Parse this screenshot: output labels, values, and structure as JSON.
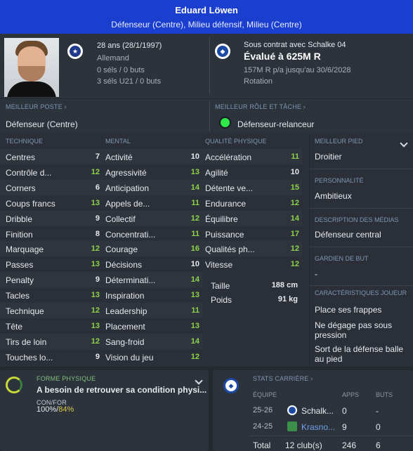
{
  "header": {
    "player_name": "Eduard Löwen",
    "positions": "Défenseur (Centre), Milieu défensif, Milieu (Centre)"
  },
  "profile": {
    "age": "28 ans (28/1/1997)",
    "nationality": "Allemand",
    "caps": "0 séls / 0 buts",
    "u21_caps": "3 séls U21 / 0 buts",
    "contract": "Sous contrat avec Schalke 04",
    "value": "Évalué à 625M R",
    "wage": "157M R p/a jusqu'au 30/6/2028",
    "squad_status": "Rotation"
  },
  "best_position": {
    "label": "MEILLEUR POSTE",
    "value": "Défenseur (Centre)"
  },
  "best_role": {
    "label": "MEILLEUR RÔLE ET TÂCHE",
    "value": "Défenseur-relanceur"
  },
  "technique": {
    "label": "TECHNIQUE",
    "items": [
      {
        "name": "Centres",
        "value": "7",
        "color": "white"
      },
      {
        "name": "Contrôle d...",
        "value": "12",
        "color": "green"
      },
      {
        "name": "Corners",
        "value": "6",
        "color": "white"
      },
      {
        "name": "Coups francs",
        "value": "13",
        "color": "green"
      },
      {
        "name": "Dribble",
        "value": "9",
        "color": "white"
      },
      {
        "name": "Finition",
        "value": "8",
        "color": "white"
      },
      {
        "name": "Marquage",
        "value": "12",
        "color": "green"
      },
      {
        "name": "Passes",
        "value": "13",
        "color": "green"
      },
      {
        "name": "Penalty",
        "value": "9",
        "color": "white"
      },
      {
        "name": "Tacles",
        "value": "13",
        "color": "green"
      },
      {
        "name": "Technique",
        "value": "12",
        "color": "green"
      },
      {
        "name": "Tête",
        "value": "13",
        "color": "green"
      },
      {
        "name": "Tirs de loin",
        "value": "12",
        "color": "green"
      },
      {
        "name": "Touches lo...",
        "value": "9",
        "color": "white"
      }
    ]
  },
  "mental": {
    "label": "MENTAL",
    "items": [
      {
        "name": "Activité",
        "value": "10",
        "color": "white"
      },
      {
        "name": "Agressivité",
        "value": "13",
        "color": "green"
      },
      {
        "name": "Anticipation",
        "value": "14",
        "color": "green"
      },
      {
        "name": "Appels de...",
        "value": "11",
        "color": "green"
      },
      {
        "name": "Collectif",
        "value": "12",
        "color": "green"
      },
      {
        "name": "Concentrati...",
        "value": "11",
        "color": "green"
      },
      {
        "name": "Courage",
        "value": "16",
        "color": "green"
      },
      {
        "name": "Décisions",
        "value": "10",
        "color": "white"
      },
      {
        "name": "Déterminati...",
        "value": "14",
        "color": "green"
      },
      {
        "name": "Inspiration",
        "value": "13",
        "color": "green"
      },
      {
        "name": "Leadership",
        "value": "11",
        "color": "green"
      },
      {
        "name": "Placement",
        "value": "13",
        "color": "green"
      },
      {
        "name": "Sang-froid",
        "value": "14",
        "color": "green"
      },
      {
        "name": "Vision du jeu",
        "value": "12",
        "color": "green"
      }
    ]
  },
  "physical": {
    "label": "QUALITÉ PHYSIQUE",
    "items": [
      {
        "name": "Accélération",
        "value": "11",
        "color": "green"
      },
      {
        "name": "Agilité",
        "value": "10",
        "color": "white"
      },
      {
        "name": "Détente ve...",
        "value": "15",
        "color": "green"
      },
      {
        "name": "Endurance",
        "value": "12",
        "color": "green"
      },
      {
        "name": "Équilibre",
        "value": "14",
        "color": "green"
      },
      {
        "name": "Puissance",
        "value": "17",
        "color": "green"
      },
      {
        "name": "Qualités ph...",
        "value": "12",
        "color": "green"
      },
      {
        "name": "Vitesse",
        "value": "12",
        "color": "green"
      }
    ],
    "height_label": "Taille",
    "height_value": "188 cm",
    "weight_label": "Poids",
    "weight_value": "91 kg"
  },
  "right_panel": {
    "best_foot_label": "MEILLEUR PIED",
    "best_foot": "Droitier",
    "personality_label": "PERSONNALITÉ",
    "personality": "Ambitieux",
    "media_label": "DESCRIPTION DES MÉDIAS",
    "media": "Défenseur central",
    "gk_label": "GARDIEN DE BUT",
    "gk": "-",
    "traits_label": "CARACTÉRISTIQUES JOUEUR",
    "traits": [
      "Place ses frappes",
      "Ne dégage pas sous pression",
      "Sort de la défense balle au pied"
    ]
  },
  "fitness": {
    "label": "FORME PHYSIQUE",
    "status": "A besoin de retrouver sa condition physi...",
    "conf_label": "CON/FOR",
    "conf_a": "100%",
    "conf_sep": "/",
    "conf_b": "84%"
  },
  "career": {
    "label": "STATS CARRIÈRE",
    "col_team": "ÉQUIPE",
    "col_apps": "APPS",
    "col_goals": "BUTS",
    "rows": [
      {
        "season": "25-26",
        "team": "Schalk...",
        "apps": "0",
        "goals": "-"
      },
      {
        "season": "24-25",
        "team": "Krasno...",
        "apps": "9",
        "goals": "0"
      }
    ],
    "total_label": "Total",
    "total_team": "12 club(s)",
    "total_apps": "246",
    "total_goals": "6"
  },
  "colors": {
    "header_blue": "#1a3fcf",
    "attr_green": "#8ed24c",
    "role_green": "#2ee84a",
    "section_label": "#7f95b5"
  }
}
